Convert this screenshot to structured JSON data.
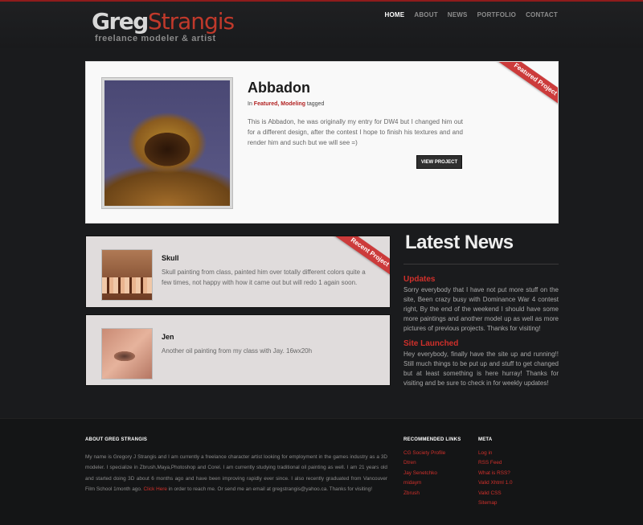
{
  "site": {
    "logo_first": "Greg",
    "logo_last": "Strangis",
    "tagline": "freelance modeler & artist"
  },
  "nav": [
    {
      "label": "HOME",
      "active": true
    },
    {
      "label": "ABOUT"
    },
    {
      "label": "NEWS"
    },
    {
      "label": "PORTFOLIO"
    },
    {
      "label": "CONTACT"
    }
  ],
  "featured": {
    "ribbon": "Featured Project",
    "title": "Abbadon",
    "meta_prefix": "In",
    "categories": "Featured, Modeling",
    "meta_suffix": "tagged",
    "description": "This is Abbadon, he was originally my entry for DW4 but I changed him out for a different design, after the contest I hope to finish his textures and and render him and such but we will see =)",
    "button": "VIEW PROJECT"
  },
  "recent": {
    "ribbon": "Recent Project",
    "items": [
      {
        "title": "Skull",
        "description": "Skull painting from class, painted him over totally different colors quite a few times, not happy with how it came out but will redo 1 again soon."
      },
      {
        "title": "Jen",
        "description": "Another oil painting from my class with Jay. 16wx20h"
      }
    ]
  },
  "news": {
    "heading": "Latest News",
    "items": [
      {
        "title": "Updates",
        "body": "Sorry everybody that I have not put more stuff on the site, Been crazy busy with Dominance War 4 contest right, By the end of the weekend I should have some more paintings and another model up as well as more pictures of previous projects. Thanks for visiting!"
      },
      {
        "title": "Site Launched",
        "body": "Hey everybody, finally have the site up and running!! Still much things to be put up and stuff to get changed but at least something is here hurray! Thanks for visiting and be sure to check in for weekly updates!"
      }
    ]
  },
  "footer": {
    "about_heading": "ABOUT GREG STRANGIS",
    "about_text_1": "My name is Gregory J Strangis and I am currently a freelance character artist looking for employment in the games industry as a 3D modeler. I specialize in Zbrush,Maya,Photoshop and Corel. I am currently studying traditional oil painting as well. I am 21 years old and started doing 3D about 6 months ago and have been improving rapidly ever since. I also recently graduated from Vancouver Film School 1month ago.",
    "about_link": "Click Here",
    "about_text_2": "in order to reach me. Or send me an email at gregstrangis@yahoo.ca.  Thanks for visiting!",
    "links_heading": "RECOMMENDED LINKS",
    "links": [
      "CG Society Profile",
      "Dtren",
      "Jay Senetchko",
      "midaym",
      "Zbrush"
    ],
    "meta_heading": "META",
    "meta": [
      "Log in",
      "RSS Feed",
      "What is RSS?",
      "Valid Xhtml 1.0",
      "Valid CSS",
      "Sitemap"
    ]
  },
  "colors": {
    "accent": "#d0302b",
    "background": "#1a1b1d",
    "card_light": "#f9f9f9",
    "card_gray": "#e0dcdc"
  }
}
